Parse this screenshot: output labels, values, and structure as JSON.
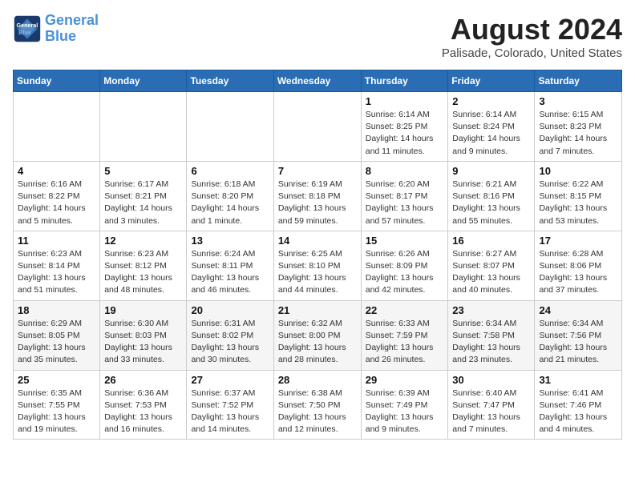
{
  "header": {
    "logo_line1": "General",
    "logo_line2": "Blue",
    "month_year": "August 2024",
    "location": "Palisade, Colorado, United States"
  },
  "days_of_week": [
    "Sunday",
    "Monday",
    "Tuesday",
    "Wednesday",
    "Thursday",
    "Friday",
    "Saturday"
  ],
  "weeks": [
    [
      {
        "day": "",
        "content": ""
      },
      {
        "day": "",
        "content": ""
      },
      {
        "day": "",
        "content": ""
      },
      {
        "day": "",
        "content": ""
      },
      {
        "day": "1",
        "content": "Sunrise: 6:14 AM\nSunset: 8:25 PM\nDaylight: 14 hours\nand 11 minutes."
      },
      {
        "day": "2",
        "content": "Sunrise: 6:14 AM\nSunset: 8:24 PM\nDaylight: 14 hours\nand 9 minutes."
      },
      {
        "day": "3",
        "content": "Sunrise: 6:15 AM\nSunset: 8:23 PM\nDaylight: 14 hours\nand 7 minutes."
      }
    ],
    [
      {
        "day": "4",
        "content": "Sunrise: 6:16 AM\nSunset: 8:22 PM\nDaylight: 14 hours\nand 5 minutes."
      },
      {
        "day": "5",
        "content": "Sunrise: 6:17 AM\nSunset: 8:21 PM\nDaylight: 14 hours\nand 3 minutes."
      },
      {
        "day": "6",
        "content": "Sunrise: 6:18 AM\nSunset: 8:20 PM\nDaylight: 14 hours\nand 1 minute."
      },
      {
        "day": "7",
        "content": "Sunrise: 6:19 AM\nSunset: 8:18 PM\nDaylight: 13 hours\nand 59 minutes."
      },
      {
        "day": "8",
        "content": "Sunrise: 6:20 AM\nSunset: 8:17 PM\nDaylight: 13 hours\nand 57 minutes."
      },
      {
        "day": "9",
        "content": "Sunrise: 6:21 AM\nSunset: 8:16 PM\nDaylight: 13 hours\nand 55 minutes."
      },
      {
        "day": "10",
        "content": "Sunrise: 6:22 AM\nSunset: 8:15 PM\nDaylight: 13 hours\nand 53 minutes."
      }
    ],
    [
      {
        "day": "11",
        "content": "Sunrise: 6:23 AM\nSunset: 8:14 PM\nDaylight: 13 hours\nand 51 minutes."
      },
      {
        "day": "12",
        "content": "Sunrise: 6:23 AM\nSunset: 8:12 PM\nDaylight: 13 hours\nand 48 minutes."
      },
      {
        "day": "13",
        "content": "Sunrise: 6:24 AM\nSunset: 8:11 PM\nDaylight: 13 hours\nand 46 minutes."
      },
      {
        "day": "14",
        "content": "Sunrise: 6:25 AM\nSunset: 8:10 PM\nDaylight: 13 hours\nand 44 minutes."
      },
      {
        "day": "15",
        "content": "Sunrise: 6:26 AM\nSunset: 8:09 PM\nDaylight: 13 hours\nand 42 minutes."
      },
      {
        "day": "16",
        "content": "Sunrise: 6:27 AM\nSunset: 8:07 PM\nDaylight: 13 hours\nand 40 minutes."
      },
      {
        "day": "17",
        "content": "Sunrise: 6:28 AM\nSunset: 8:06 PM\nDaylight: 13 hours\nand 37 minutes."
      }
    ],
    [
      {
        "day": "18",
        "content": "Sunrise: 6:29 AM\nSunset: 8:05 PM\nDaylight: 13 hours\nand 35 minutes."
      },
      {
        "day": "19",
        "content": "Sunrise: 6:30 AM\nSunset: 8:03 PM\nDaylight: 13 hours\nand 33 minutes."
      },
      {
        "day": "20",
        "content": "Sunrise: 6:31 AM\nSunset: 8:02 PM\nDaylight: 13 hours\nand 30 minutes."
      },
      {
        "day": "21",
        "content": "Sunrise: 6:32 AM\nSunset: 8:00 PM\nDaylight: 13 hours\nand 28 minutes."
      },
      {
        "day": "22",
        "content": "Sunrise: 6:33 AM\nSunset: 7:59 PM\nDaylight: 13 hours\nand 26 minutes."
      },
      {
        "day": "23",
        "content": "Sunrise: 6:34 AM\nSunset: 7:58 PM\nDaylight: 13 hours\nand 23 minutes."
      },
      {
        "day": "24",
        "content": "Sunrise: 6:34 AM\nSunset: 7:56 PM\nDaylight: 13 hours\nand 21 minutes."
      }
    ],
    [
      {
        "day": "25",
        "content": "Sunrise: 6:35 AM\nSunset: 7:55 PM\nDaylight: 13 hours\nand 19 minutes."
      },
      {
        "day": "26",
        "content": "Sunrise: 6:36 AM\nSunset: 7:53 PM\nDaylight: 13 hours\nand 16 minutes."
      },
      {
        "day": "27",
        "content": "Sunrise: 6:37 AM\nSunset: 7:52 PM\nDaylight: 13 hours\nand 14 minutes."
      },
      {
        "day": "28",
        "content": "Sunrise: 6:38 AM\nSunset: 7:50 PM\nDaylight: 13 hours\nand 12 minutes."
      },
      {
        "day": "29",
        "content": "Sunrise: 6:39 AM\nSunset: 7:49 PM\nDaylight: 13 hours\nand 9 minutes."
      },
      {
        "day": "30",
        "content": "Sunrise: 6:40 AM\nSunset: 7:47 PM\nDaylight: 13 hours\nand 7 minutes."
      },
      {
        "day": "31",
        "content": "Sunrise: 6:41 AM\nSunset: 7:46 PM\nDaylight: 13 hours\nand 4 minutes."
      }
    ]
  ]
}
